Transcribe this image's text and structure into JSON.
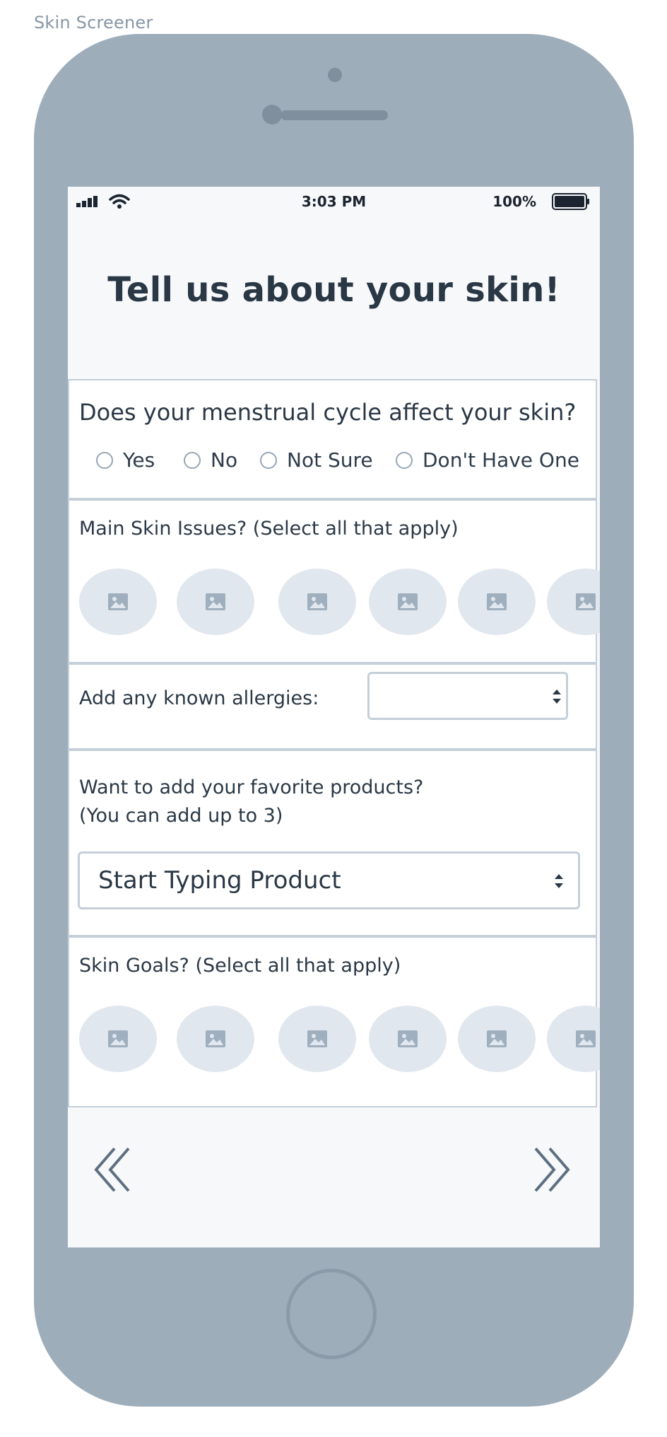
{
  "app": {
    "title": "Skin Screener"
  },
  "status_bar": {
    "time": "3:03 PM",
    "battery": "100%"
  },
  "page": {
    "title": "Tell us about your skin!"
  },
  "menstrual": {
    "question": "Does your menstrual cycle affect your skin?",
    "options": [
      "Yes",
      "No",
      "Not Sure",
      "Don't Have One"
    ]
  },
  "skin_issues": {
    "label": "Main Skin Issues? (Select all that apply)"
  },
  "allergies": {
    "label": "Add any known allergies:",
    "value": ""
  },
  "products": {
    "label_line1": "Want to add your favorite products?",
    "label_line2": "(You can add up to 3)",
    "placeholder": "Start Typing Product"
  },
  "skin_goals": {
    "label": "Skin Goals? (Select all that apply)"
  },
  "icons": {
    "back": "double-chevron-left-icon",
    "next": "double-chevron-right-icon",
    "image_placeholder": "image-placeholder-icon"
  },
  "colors": {
    "phone_body": "#9eadba",
    "screen_bg": "#f6f8fa",
    "chip_bg": "#e1e7ee",
    "text": "#2a3846"
  }
}
